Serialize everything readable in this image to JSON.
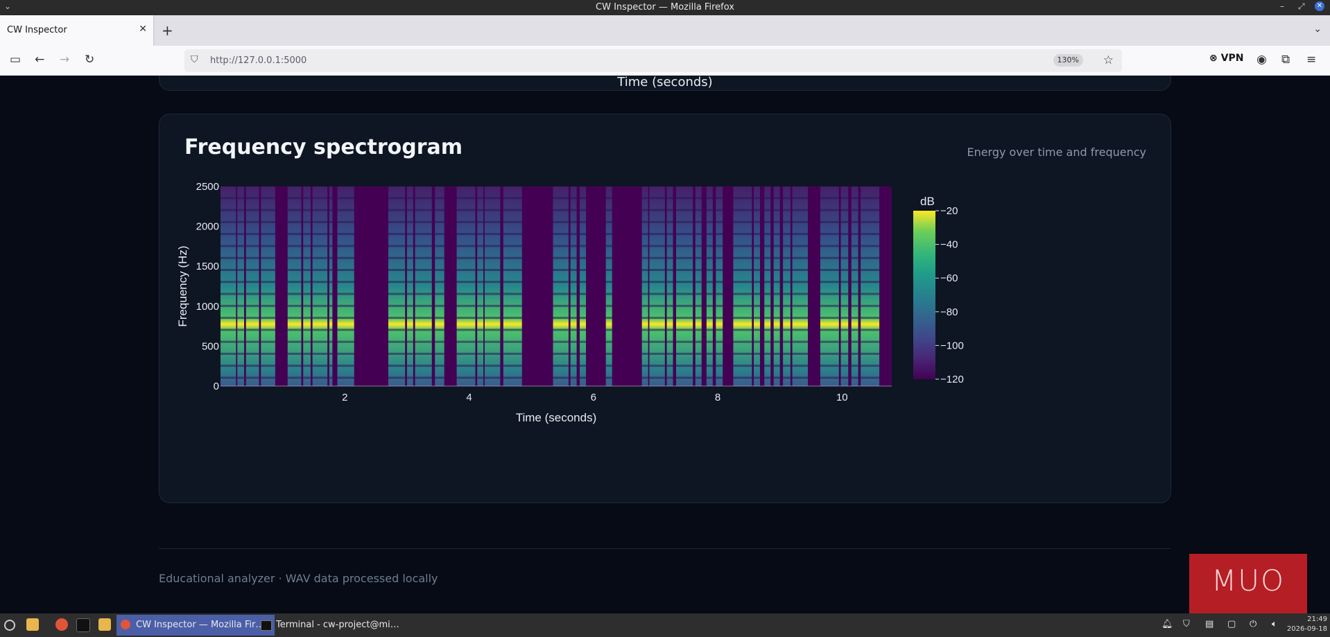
{
  "window": {
    "title": "CW Inspector — Mozilla Firefox"
  },
  "tab": {
    "label": "CW Inspector"
  },
  "navbar": {
    "url": "http://127.0.0.1:5000",
    "zoom": "130%",
    "vpn_label": "VPN"
  },
  "prev_card": {
    "xlabel": "Time (seconds)"
  },
  "spectrogram": {
    "title": "Frequency spectrogram",
    "subtitle": "Energy over time and frequency",
    "colorbar_title": "dB",
    "colorbar_ticks": [
      "−20",
      "−40",
      "−60",
      "−80",
      "−100",
      "−120"
    ]
  },
  "chart_data": {
    "type": "heatmap",
    "xlabel": "Time (seconds)",
    "ylabel": "Frequency (Hz)",
    "xlim": [
      0,
      10.8
    ],
    "ylim": [
      0,
      2500
    ],
    "x_ticks": [
      2,
      4,
      6,
      8,
      10
    ],
    "y_ticks": [
      0,
      500,
      1000,
      1500,
      2000,
      2500
    ],
    "colorscale": "viridis",
    "z_range": [
      -120,
      -20
    ],
    "tone_frequency_hz": 700,
    "tone_segments_seconds": [
      [
        0.0,
        0.25
      ],
      [
        0.27,
        0.38
      ],
      [
        0.41,
        0.62
      ],
      [
        0.65,
        0.88
      ],
      [
        1.08,
        1.3
      ],
      [
        1.33,
        1.45
      ],
      [
        1.48,
        1.72
      ],
      [
        1.75,
        1.8
      ],
      [
        1.88,
        2.15
      ],
      [
        2.7,
        2.97
      ],
      [
        3.0,
        3.1
      ],
      [
        3.13,
        3.4
      ],
      [
        3.45,
        3.6
      ],
      [
        3.8,
        4.1
      ],
      [
        4.13,
        4.23
      ],
      [
        4.25,
        4.5
      ],
      [
        4.55,
        4.85
      ],
      [
        5.35,
        5.6
      ],
      [
        5.63,
        5.73
      ],
      [
        5.78,
        5.88
      ],
      [
        6.2,
        6.3
      ],
      [
        6.78,
        6.88
      ],
      [
        6.9,
        7.15
      ],
      [
        7.18,
        7.28
      ],
      [
        7.33,
        7.6
      ],
      [
        7.64,
        7.74
      ],
      [
        7.82,
        7.92
      ],
      [
        7.97,
        8.08
      ],
      [
        8.25,
        8.55
      ],
      [
        8.58,
        8.68
      ],
      [
        8.75,
        8.85
      ],
      [
        8.9,
        9.0
      ],
      [
        9.05,
        9.17
      ],
      [
        9.2,
        9.45
      ],
      [
        9.65,
        9.95
      ],
      [
        9.98,
        10.1
      ],
      [
        10.15,
        10.26
      ],
      [
        10.3,
        10.6
      ]
    ]
  },
  "footer": {
    "text": "Educational analyzer · WAV data processed locally",
    "logo_text": "MUO"
  },
  "taskbar": {
    "tasks": [
      "CW Inspector — Mozilla Fir…",
      "Terminal - cw-project@mi…"
    ],
    "time": "21:49",
    "date": "2026-09-18"
  },
  "colors": {
    "page_bg": "#060b15",
    "card_bg": "#0e1523",
    "accent_red": "#b51e24"
  }
}
